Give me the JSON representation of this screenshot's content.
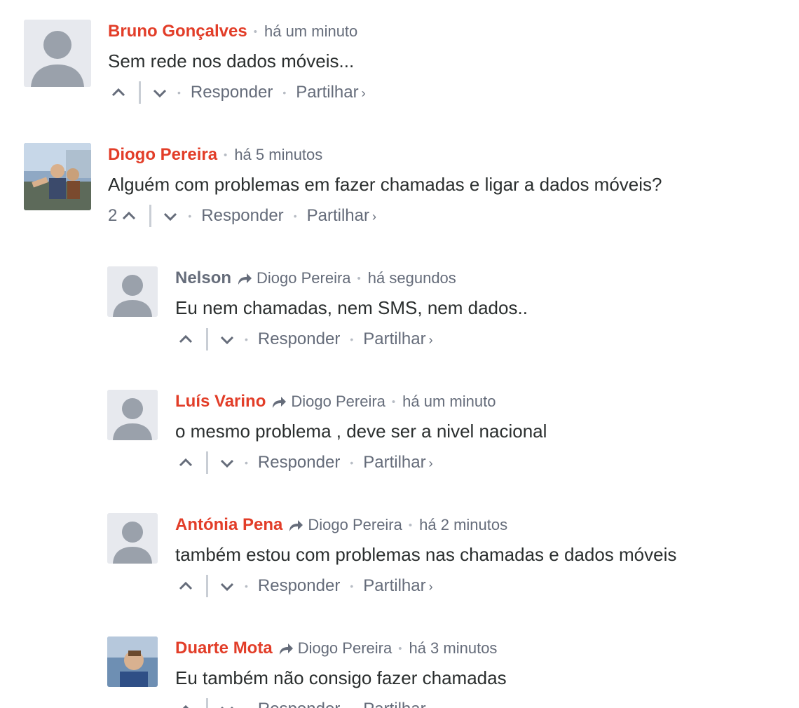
{
  "actions": {
    "reply": "Responder",
    "share": "Partilhar",
    "share_chevron": "›"
  },
  "comments": [
    {
      "author": "Bruno Gonçalves",
      "time": "há um minuto",
      "text": "Sem rede nos dados móveis...",
      "votes": ""
    },
    {
      "author": "Diogo Pereira",
      "time": "há 5 minutos",
      "text": "Alguém com problemas em fazer chamadas e ligar a dados móveis?",
      "votes": "2"
    }
  ],
  "replies": [
    {
      "author": "Nelson",
      "reply_to": "Diogo Pereira",
      "time": "há segundos",
      "text": "Eu nem chamadas, nem SMS, nem dados.."
    },
    {
      "author": "Luís Varino",
      "reply_to": "Diogo Pereira",
      "time": "há um minuto",
      "text": "o mesmo problema , deve ser a nivel nacional"
    },
    {
      "author": "Antónia Pena",
      "reply_to": "Diogo Pereira",
      "time": "há 2 minutos",
      "text": "também estou com problemas nas chamadas e dados móveis"
    },
    {
      "author": "Duarte Mota",
      "reply_to": "Diogo Pereira",
      "time": "há 3 minutos",
      "text": "Eu também não consigo fazer chamadas"
    }
  ],
  "colors": {
    "author_accent": "#e23d28",
    "muted": "#656c7a",
    "text": "#2a2e2e"
  },
  "icons": [
    "default-avatar-icon",
    "photo-avatar-icon",
    "upvote-chevron-icon",
    "downvote-chevron-icon",
    "reply-arrow-icon"
  ]
}
